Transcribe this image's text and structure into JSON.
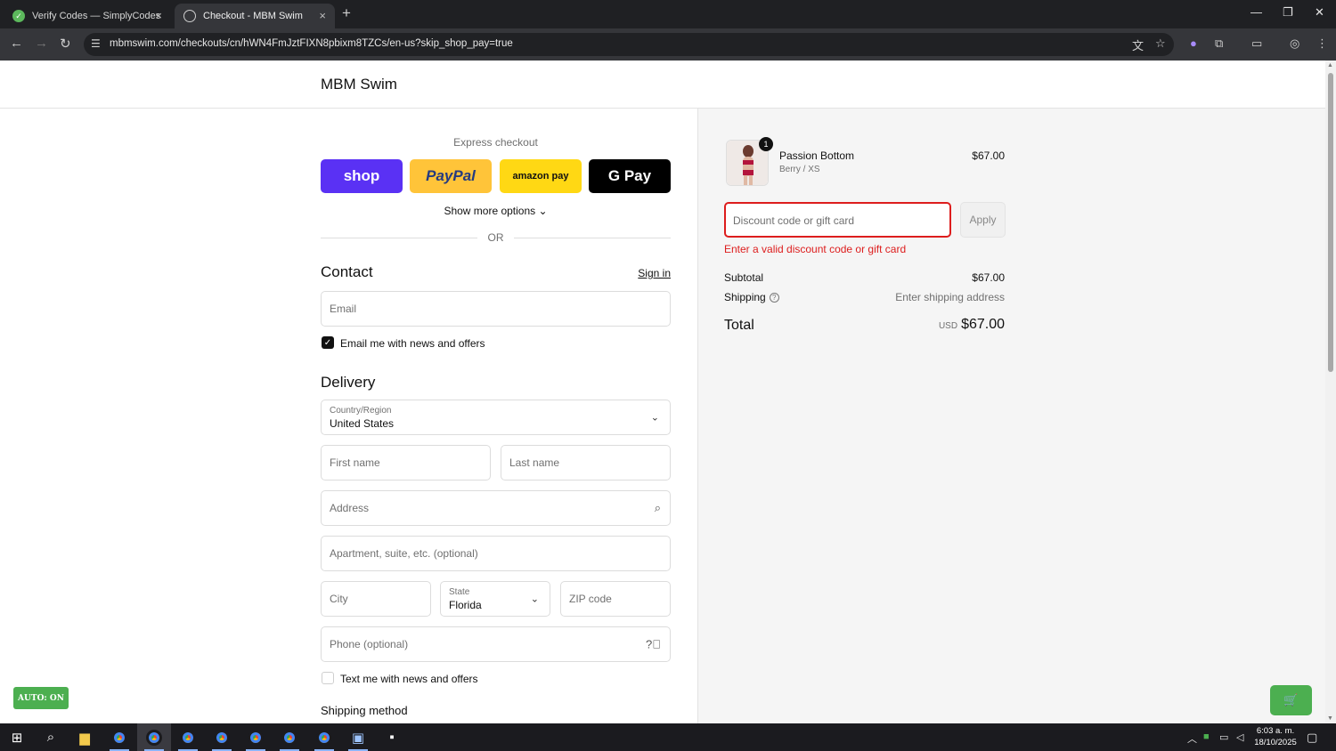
{
  "browser": {
    "tabs": [
      {
        "title": "Verify Codes — SimplyCodes",
        "close": "×"
      },
      {
        "title": "Checkout - MBM Swim",
        "close": "×"
      }
    ],
    "new_tab": "+",
    "url": "mbmswim.com/checkouts/cn/hWN4FmJztFIXN8pbixm8TZCs/en-us?skip_shop_pay=true"
  },
  "store": {
    "name": "MBM Swim"
  },
  "express": {
    "label": "Express checkout",
    "buttons": {
      "shop": "shop",
      "paypal": "PayPal",
      "amazon": "amazon pay",
      "gpay": "G Pay"
    },
    "show_more": "Show more options ⌄",
    "or": "OR"
  },
  "contact": {
    "title": "Contact",
    "sign_in": "Sign in",
    "email_placeholder": "Email",
    "news_label": "Email me with news and offers",
    "news_checked": true
  },
  "delivery": {
    "title": "Delivery",
    "country_label": "Country/Region",
    "country_value": "United States",
    "first_name_placeholder": "First name",
    "last_name_placeholder": "Last name",
    "address_placeholder": "Address",
    "apartment_placeholder": "Apartment, suite, etc. (optional)",
    "city_placeholder": "City",
    "state_label": "State",
    "state_value": "Florida",
    "zip_placeholder": "ZIP code",
    "phone_placeholder": "Phone (optional)",
    "text_label": "Text me with news and offers",
    "text_checked": false
  },
  "shipping_method": {
    "title": "Shipping method"
  },
  "summary": {
    "item": {
      "name": "Passion Bottom",
      "variant": "Berry / XS",
      "price": "$67.00",
      "quantity": "1"
    },
    "discount_placeholder": "Discount code or gift card",
    "apply_label": "Apply",
    "error": "Enter a valid discount code or gift card",
    "subtotal_label": "Subtotal",
    "subtotal_value": "$67.00",
    "shipping_label": "Shipping",
    "shipping_value": "Enter shipping address",
    "total_label": "Total",
    "total_currency": "USD",
    "total_value": "$67.00"
  },
  "overlay": {
    "auto_label": "AUTO: ON"
  },
  "taskbar": {
    "time": "6:03 a. m.",
    "date": "18/10/2025"
  },
  "colors": {
    "error": "#dd1d1d",
    "shop_pay": "#5a31f4",
    "paypal": "#ffc439",
    "amazon": "#ffd814",
    "extension_green": "#4caf50"
  }
}
